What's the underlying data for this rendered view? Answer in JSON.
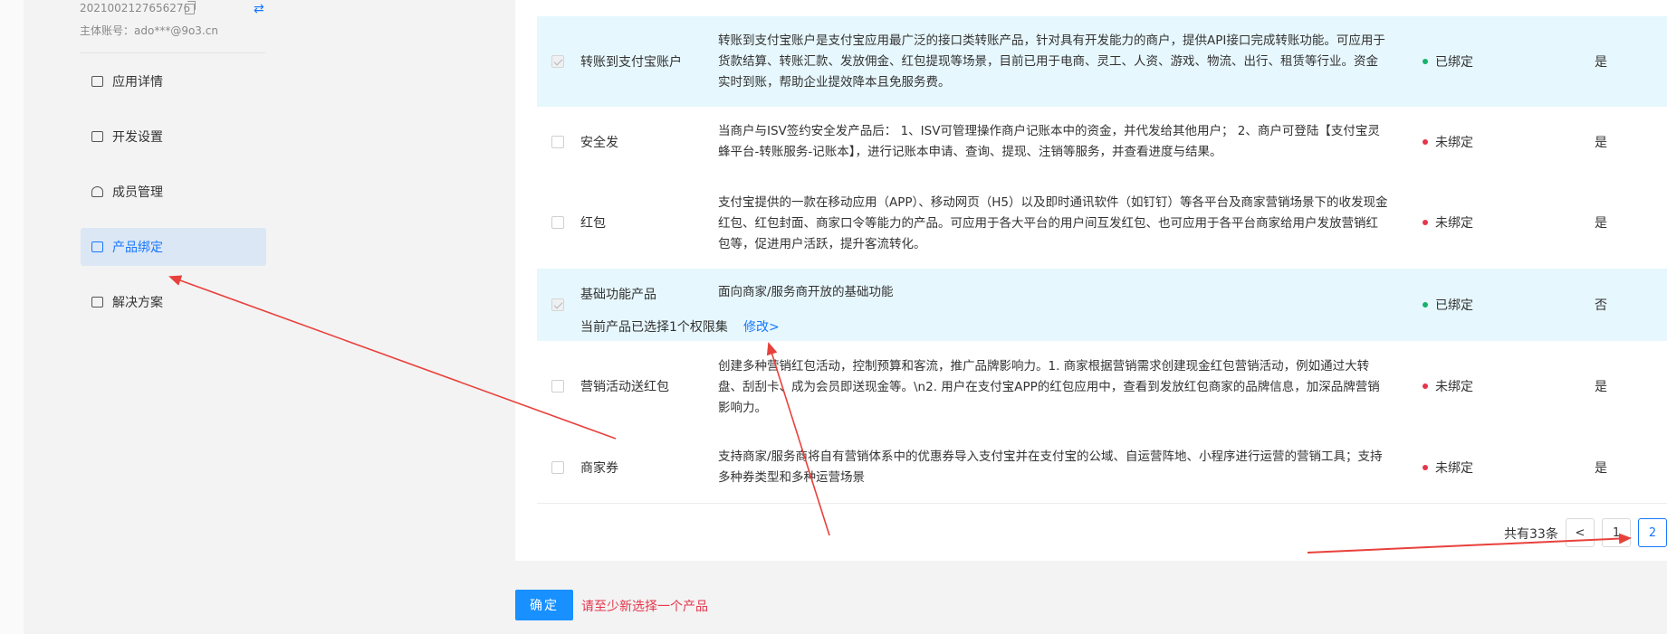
{
  "account": {
    "app_id": "2021002127656276",
    "main_account": "主体账号：ado***@9o3.cn"
  },
  "sidebar": {
    "items": [
      {
        "label": "应用详情",
        "icon": "chart-icon"
      },
      {
        "label": "开发设置",
        "icon": "settings-icon"
      },
      {
        "label": "成员管理",
        "icon": "user-icon"
      },
      {
        "label": "产品绑定",
        "icon": "link-icon"
      },
      {
        "label": "解决方案",
        "icon": "book-icon"
      }
    ],
    "active_index": 3
  },
  "products": [
    {
      "name": "转账到支付宝账户",
      "checked": true,
      "desc": "转账到支付宝账户是支付宝应用最广泛的接口类转账产品，针对具有开发能力的商户，提供API接口完成转账功能。可应用于货款结算、转账汇款、发放佣金、红包提现等场景，目前已用于电商、灵工、人资、游戏、物流、出行、租赁等行业。资金实时到账，帮助企业提效降本且免服务费。",
      "status": "已绑定",
      "bound": true,
      "required": "是"
    },
    {
      "name": "安全发",
      "checked": false,
      "desc": "当商户与ISV签约安全发产品后： 1、ISV可管理操作商户记账本中的资金，并代发给其他用户； 2、商户可登陆【支付宝灵蜂平台-转账服务-记账本】，进行记账本申请、查询、提现、注销等服务，并查看进度与结果。",
      "status": "未绑定",
      "bound": false,
      "required": "是"
    },
    {
      "name": "红包",
      "checked": false,
      "desc": "支付宝提供的一款在移动应用（APP）、移动网页（H5）以及即时通讯软件（如钉钉）等各平台及商家营销场景下的收发现金红包、红包封面、商家口令等能力的产品。可应用于各大平台的用户间互发红包、也可应用于各平台商家给用户发放营销红包等，促进用户活跃，提升客流转化。",
      "status": "未绑定",
      "bound": false,
      "required": "是"
    },
    {
      "name": "基础功能产品",
      "checked": true,
      "desc": "面向商家/服务商开放的基础功能",
      "status": "已绑定",
      "bound": true,
      "required": "否",
      "scope_text": "当前产品已选择1个权限集",
      "modify_label": "修改>"
    },
    {
      "name": "营销活动送红包",
      "checked": false,
      "desc": "创建多种营销红包活动，控制预算和客流，推广品牌影响力。1. 商家根据营销需求创建现金红包营销活动，例如通过大转盘、刮刮卡、成为会员即送现金等。\\n2. 用户在支付宝APP的红包应用中，查看到发放红包商家的品牌信息，加深品牌营销影响力。",
      "status": "未绑定",
      "bound": false,
      "required": "是"
    },
    {
      "name": "商家券",
      "checked": false,
      "desc": "支持商家/服务商将自有营销体系中的优惠券导入支付宝并在支付宝的公域、自运营阵地、小程序进行运营的营销工具；支持多种券类型和多种运营场景",
      "status": "未绑定",
      "bound": false,
      "required": "是"
    }
  ],
  "pagination": {
    "total": "共有33条",
    "prev": "<",
    "pages": [
      "1",
      "2"
    ],
    "current": "2"
  },
  "footer": {
    "confirm_label": "确定",
    "warning": "请至少新选择一个产品"
  },
  "colors": {
    "accent": "#1677ff",
    "selected_row": "#e6f7fd",
    "bound": "#17b26a",
    "unbound": "#e5364b",
    "annotation_arrow": "#e8413c"
  }
}
